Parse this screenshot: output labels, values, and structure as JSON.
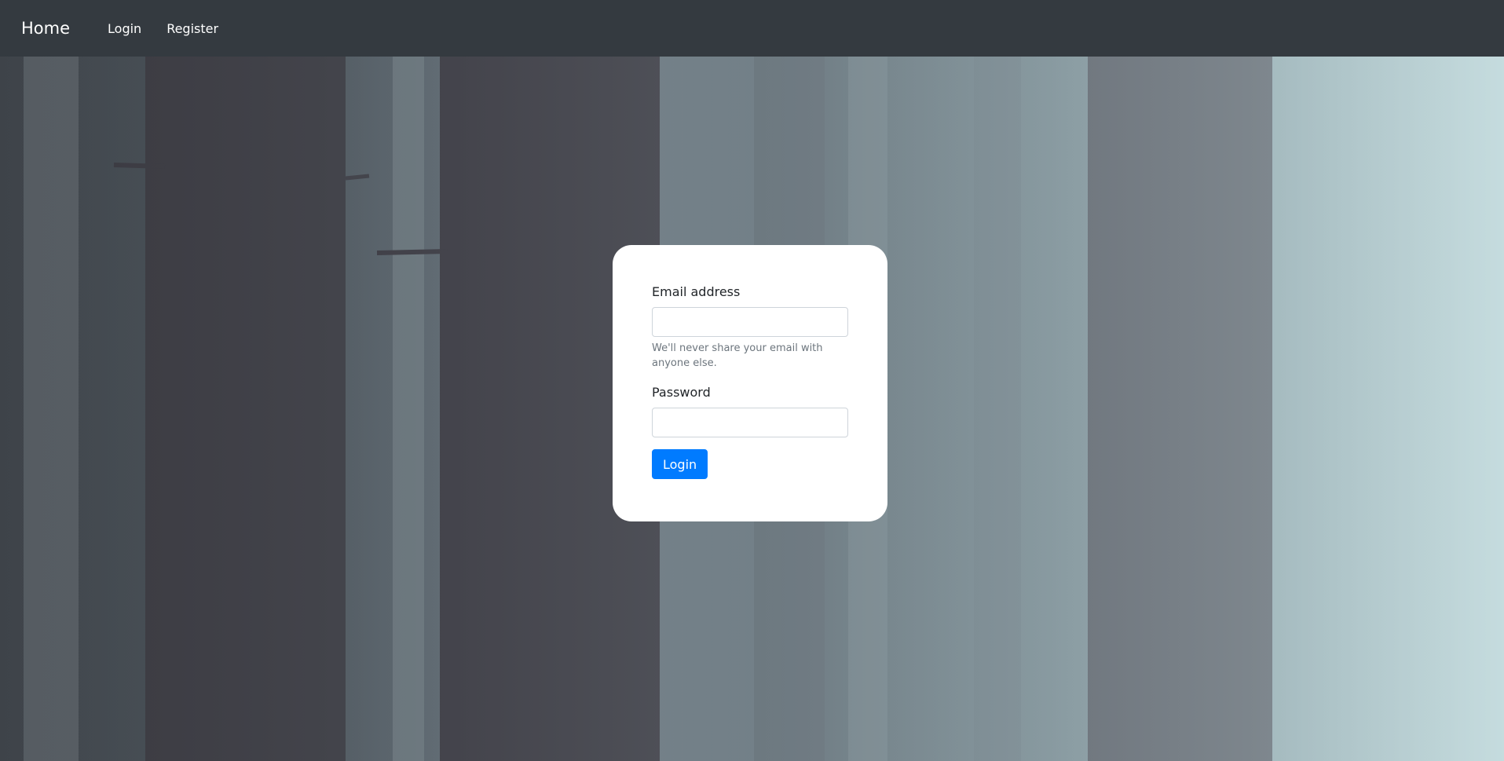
{
  "navbar": {
    "brand": "Home",
    "links": [
      "Login",
      "Register"
    ]
  },
  "form": {
    "email_label": "Email address",
    "email_value": "",
    "email_help": "We'll never share your email with anyone else.",
    "password_label": "Password",
    "password_value": "",
    "submit_label": "Login"
  },
  "colors": {
    "navbar_bg": "#343a40",
    "primary": "#007bff",
    "card_bg": "#ffffff"
  }
}
